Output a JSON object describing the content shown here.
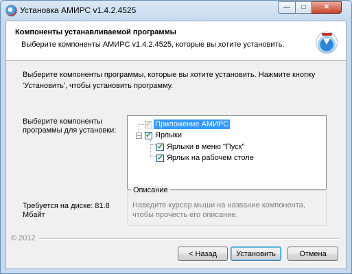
{
  "window": {
    "title": "Установка АМИРС v1.4.2.4525"
  },
  "header": {
    "title": "Компоненты устанавливаемой программы",
    "subtitle": "Выберите компоненты АМИРС v1.4.2.4525, которые вы хотите установить."
  },
  "intro": {
    "line1": "Выберите компоненты программы, которые вы хотите установить. Нажмите кнопку",
    "line2": "'Установить', чтобы установить программу."
  },
  "choose_label": {
    "line1": "Выберите компоненты",
    "line2": "программы для установки:"
  },
  "tree": {
    "items": [
      {
        "label": "Приложение АМИРС",
        "checked": true,
        "disabled": true,
        "selected": true
      },
      {
        "label": "Ярлыки",
        "checked": true,
        "expanded": true
      },
      {
        "label": "Ярлыки в меню \"Пуск\"",
        "checked": true
      },
      {
        "label": "Ярлык на рабочем столе",
        "checked": true
      }
    ]
  },
  "description": {
    "title": "Описание",
    "line1": "Наведите курсор мыши на название компонента,",
    "line2": "чтобы прочесть его описание."
  },
  "disk_space": {
    "line1": "Требуется на диске: 81.8",
    "line2": "Мбайт"
  },
  "footer": {
    "copyright": "© 2012"
  },
  "buttons": {
    "back": "< Назад",
    "install": "Установить",
    "cancel": "Отмена"
  },
  "colors": {
    "selection": "#3399ff",
    "check": "#219a2a",
    "close_button": "#c7452c"
  }
}
